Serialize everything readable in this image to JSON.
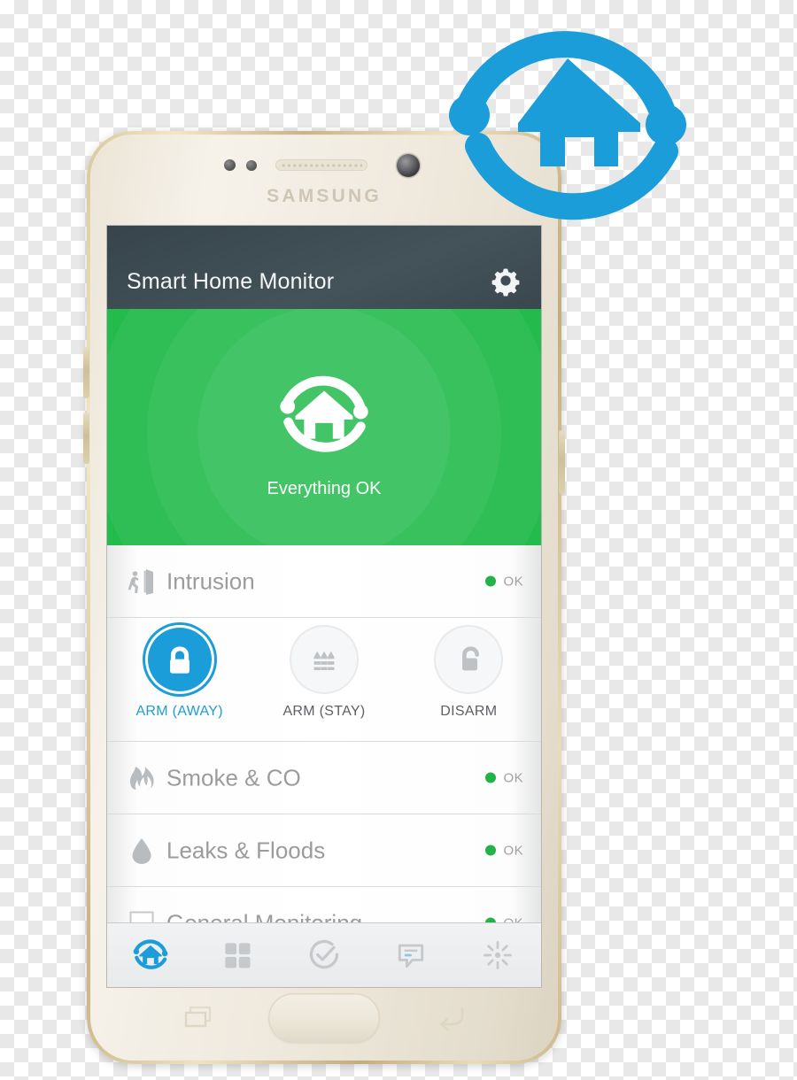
{
  "device": {
    "brand": "SAMSUNG",
    "hardware": {
      "front_camera": "front-camera",
      "earpiece_speaker": "earpiece-speaker",
      "proximity_sensor": "proximity-sensor",
      "light_sensor": "light-sensor",
      "volume_up": "volume-up-button",
      "volume_down": "volume-down-button",
      "power": "power-button",
      "home": "home-button",
      "recents": "recents-button",
      "back": "back-button"
    }
  },
  "app": {
    "title": "Smart Home Monitor",
    "settings_icon": "gear-icon",
    "brand_logo_icon": "home-circle-logo-icon",
    "accent_blue": "#1b9dd9",
    "status_green": "#22b24a",
    "header_bg": "#3f4d55",
    "hero_green": "#22bb4c"
  },
  "hero": {
    "status_text": "Everything OK",
    "logo_icon": "home-circle-logo-icon"
  },
  "sections": [
    {
      "id": "intrusion",
      "label": "Intrusion",
      "icon": "person-exit-door-icon",
      "status": "OK",
      "status_color": "#22b24a",
      "expanded": true,
      "modes": [
        {
          "label": "ARM (AWAY)",
          "icon": "padlock-closed-icon",
          "active": true
        },
        {
          "label": "ARM (STAY)",
          "icon": "fence-icon",
          "active": false
        },
        {
          "label": "DISARM",
          "icon": "padlock-open-icon",
          "active": false
        }
      ]
    },
    {
      "id": "smoke-co",
      "label": "Smoke & CO",
      "icon": "flame-icon",
      "status": "OK",
      "status_color": "#22b24a",
      "expanded": false
    },
    {
      "id": "leaks-floods",
      "label": "Leaks & Floods",
      "icon": "water-droplet-icon",
      "status": "OK",
      "status_color": "#22b24a",
      "expanded": false
    },
    {
      "id": "general-monitoring",
      "label": "General Monitoring",
      "icon": "square-outline-icon",
      "status": "OK",
      "status_color": "#22b24a",
      "expanded": false
    }
  ],
  "bottom_nav": [
    {
      "id": "home",
      "icon": "home-circle-logo-icon",
      "active": true
    },
    {
      "id": "things",
      "icon": "grid-squares-icon",
      "active": false
    },
    {
      "id": "routines",
      "icon": "check-circle-icon",
      "active": false
    },
    {
      "id": "messages",
      "icon": "speech-bubble-icon",
      "active": false
    },
    {
      "id": "smartapps",
      "icon": "sun-burst-icon",
      "active": false
    }
  ]
}
